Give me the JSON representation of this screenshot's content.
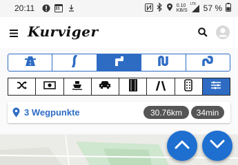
{
  "status": {
    "time": "20:11",
    "calendar_day": "31",
    "net_speed_value": "0.10",
    "net_speed_unit": "KB/S",
    "network_type": "LTE",
    "battery": "57 %"
  },
  "app": {
    "logo_text": "Kurviger"
  },
  "road_types": [
    {
      "icon": "highway-icon",
      "active": false
    },
    {
      "icon": "curvy-road-icon",
      "active": false
    },
    {
      "icon": "curvy-road-2-icon",
      "active": true
    },
    {
      "icon": "very-curvy-road-icon",
      "active": false
    },
    {
      "icon": "extreme-curvy-road-icon",
      "active": false
    }
  ],
  "avoid_options": [
    {
      "icon": "shuffle-icon"
    },
    {
      "icon": "toll-icon"
    },
    {
      "icon": "ferry-icon"
    },
    {
      "icon": "car-icon"
    },
    {
      "icon": "unpaved-road-icon"
    },
    {
      "icon": "narrow-road-icon"
    },
    {
      "icon": "remote-icon"
    },
    {
      "icon": "settings-sliders-icon"
    }
  ],
  "route": {
    "waypoints_label": "3 Wegpunkte",
    "distance": "30.76km",
    "duration": "34min"
  },
  "colors": {
    "accent": "#2e6cc4",
    "fab": "#1f6fd1",
    "pill": "#555555"
  }
}
